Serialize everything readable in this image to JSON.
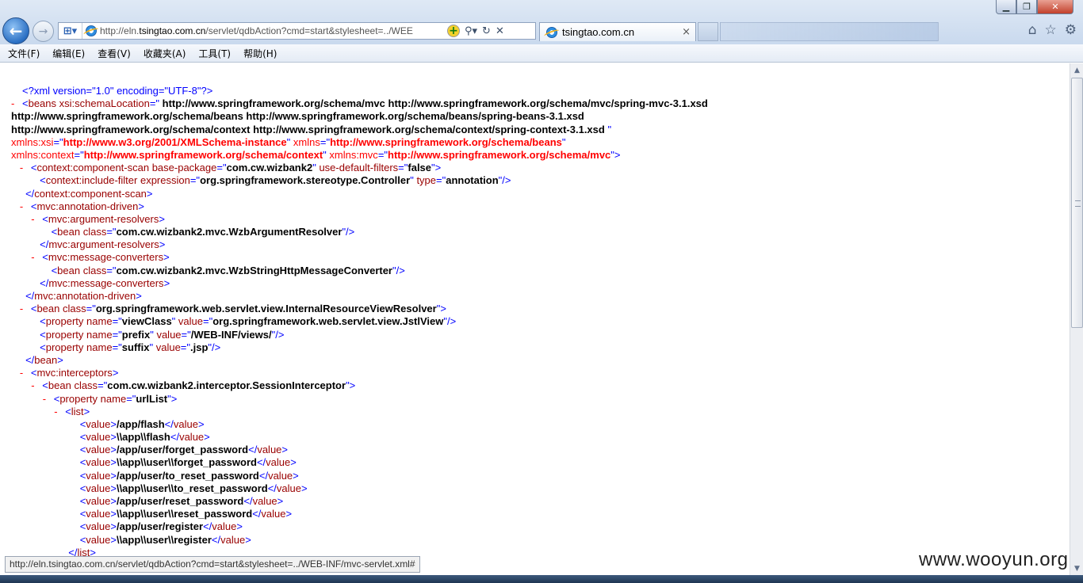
{
  "window": {
    "min_icon": "minimize-icon",
    "max_icon": "maximize-icon",
    "close_icon": "close-icon"
  },
  "nav": {
    "back_icon": "back-arrow-icon",
    "forward_icon": "forward-arrow-icon"
  },
  "address": {
    "url_prefix": "http://eln.",
    "url_host": "tsingtao.com.cn",
    "url_suffix": "/servlet/qdbAction?cmd=start&stylesheet=../WEE"
  },
  "tab": {
    "label": "tsingtao.com.cn",
    "close_glyph": "×"
  },
  "menu": [
    "文件(F)",
    "编辑(E)",
    "查看(V)",
    "收藏夹(A)",
    "工具(T)",
    "帮助(H)"
  ],
  "xml": {
    "decl": "<?xml version=\"1.0\" encoding=\"UTF-8\"?>",
    "schema_location_1": " http://www.springframework.org/schema/mvc http://www.springframework.org/schema/mvc/spring-mvc-3.1.xsd",
    "schema_location_2": "http://www.springframework.org/schema/beans http://www.springframework.org/schema/beans/spring-beans-3.1.xsd",
    "schema_location_3": "http://www.springframework.org/schema/context http://www.springframework.org/schema/context/spring-context-3.1.xsd ",
    "xmlns_xsi": "http://www.w3.org/2001/XMLSchema-instance",
    "xmlns": "http://www.springframework.org/schema/beans",
    "xmlns_context": "http://www.springframework.org/schema/context",
    "xmlns_mvc": "http://www.springframework.org/schema/mvc",
    "scan_package": "com.cw.wizbank2",
    "scan_default_filters": "false",
    "filter_expression": "org.springframework.stereotype.Controller",
    "filter_type": "annotation",
    "argument_resolver_class": "com.cw.wizbank2.mvc.WzbArgumentResolver",
    "message_converter_class": "com.cw.wizbank2.mvc.WzbStringHttpMessageConverter",
    "view_resolver_class": "org.springframework.web.servlet.view.InternalResourceViewResolver",
    "prop_viewclass_name": "viewClass",
    "prop_viewclass_value": "org.springframework.web.servlet.view.JstlView",
    "prop_prefix_name": "prefix",
    "prop_prefix_value": "/WEB-INF/views/",
    "prop_suffix_name": "suffix",
    "prop_suffix_value": ".jsp",
    "interceptor_class": "com.cw.wizbank2.interceptor.SessionInterceptor",
    "prop_urllist_name": "urlList",
    "values": [
      "/app/flash",
      "\\\\app\\\\flash",
      "/app/user/forget_password",
      "\\\\app\\\\user\\\\forget_password",
      "/app/user/to_reset_password",
      "\\\\app\\\\user\\\\to_reset_password",
      "/app/user/reset_password",
      "\\\\app\\\\user\\\\reset_password",
      "/app/user/register",
      "\\\\app\\\\user\\\\register"
    ]
  },
  "status_url": "http://eln.tsingtao.com.cn/servlet/qdbAction?cmd=start&stylesheet=../WEB-INF/mvc-servlet.xml#",
  "watermark": "www.wooyun.org"
}
